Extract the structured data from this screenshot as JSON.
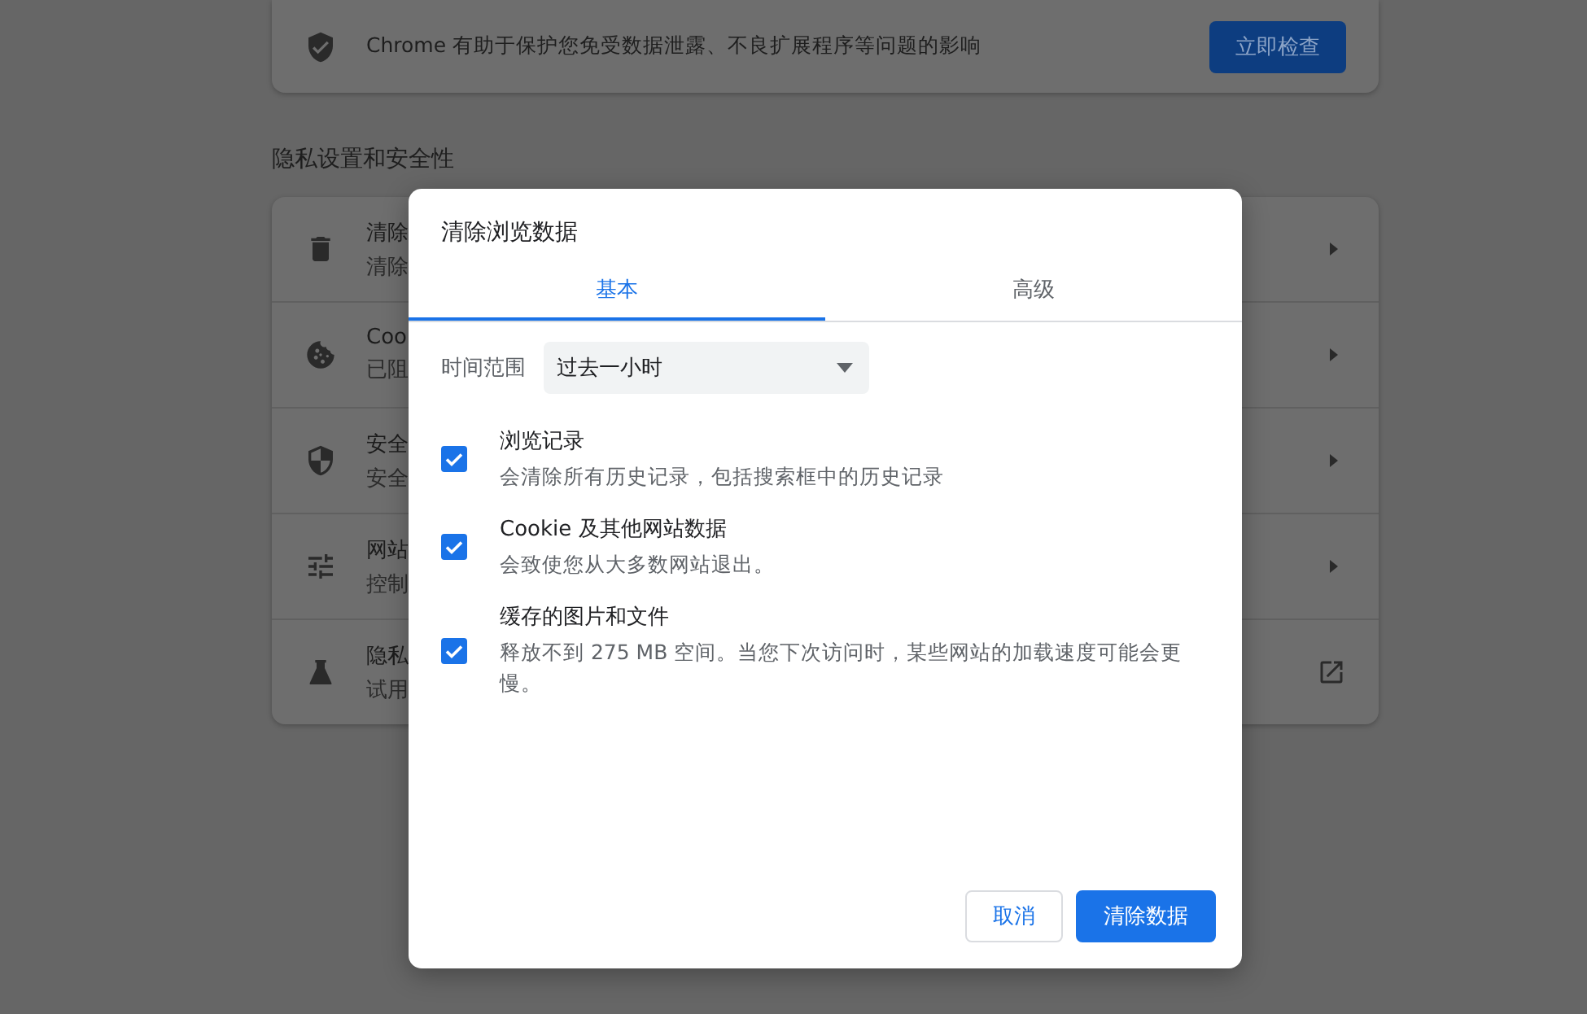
{
  "safety_card": {
    "text": "Chrome 有助于保护您免受数据泄露、不良扩展程序等问题的影响",
    "button": "立即检查"
  },
  "privacy_section": {
    "heading": "隐私设置和安全性",
    "rows": [
      {
        "kind": "arrow",
        "title": "清除",
        "subtitle": "清除"
      },
      {
        "kind": "arrow",
        "title": "Coo",
        "subtitle": "已阻"
      },
      {
        "kind": "arrow",
        "title": "安全",
        "subtitle": "安全"
      },
      {
        "kind": "arrow",
        "title": "网站",
        "subtitle": "控制"
      },
      {
        "kind": "external",
        "title": "隐私",
        "subtitle": "试用"
      }
    ]
  },
  "dialog": {
    "title": "清除浏览数据",
    "tabs": [
      {
        "label": "基本",
        "selected": true
      },
      {
        "label": "高级",
        "selected": false
      }
    ],
    "time_range": {
      "label": "时间范围",
      "value": "过去一小时"
    },
    "options": [
      {
        "title": "浏览记录",
        "description": "会清除所有历史记录，包括搜索框中的历史记录",
        "checked": true
      },
      {
        "title": "Cookie 及其他网站数据",
        "description": "会致使您从大多数网站退出。",
        "checked": true
      },
      {
        "title": "缓存的图片和文件",
        "description": "释放不到 275 MB 空间。当您下次访问时，某些网站的加载速度可能会更慢。",
        "checked": true
      }
    ],
    "buttons": [
      {
        "label": "取消",
        "kind": "secondary"
      },
      {
        "label": "清除数据",
        "kind": "primary"
      }
    ]
  }
}
